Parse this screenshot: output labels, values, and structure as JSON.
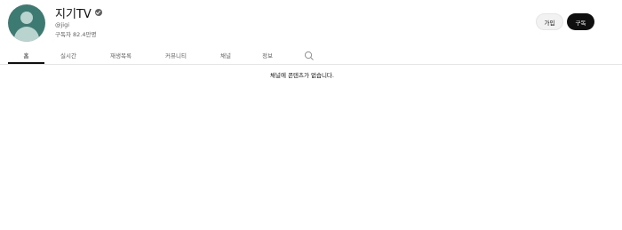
{
  "channel": {
    "name": "지기TV",
    "handle": "@jigi",
    "subscribers": "구독자 82.4만명",
    "verified_icon": "verified-check-icon",
    "avatar_color": "#3d7a72"
  },
  "actions": {
    "join_label": "가입",
    "subscribe_label": "구독"
  },
  "tabs": [
    {
      "label": "홈",
      "active": true
    },
    {
      "label": "실시간",
      "active": false
    },
    {
      "label": "재생목록",
      "active": false
    },
    {
      "label": "커뮤니티",
      "active": false
    },
    {
      "label": "채널",
      "active": false
    },
    {
      "label": "정보",
      "active": false
    }
  ],
  "search_icon": "search-icon",
  "content": {
    "empty_message": "채널에 콘텐츠가 없습니다."
  }
}
